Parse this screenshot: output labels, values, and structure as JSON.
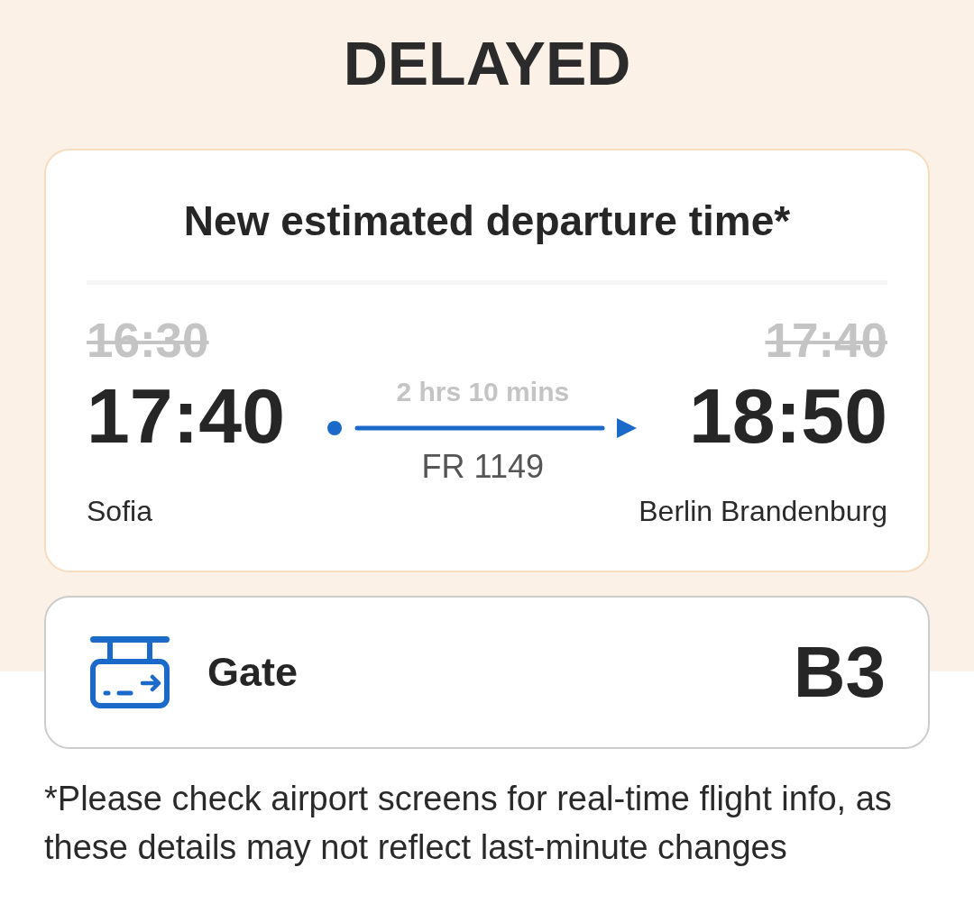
{
  "status": {
    "kind": "delayed",
    "title": "DELAYED"
  },
  "departure_card": {
    "heading": "New estimated departure time*",
    "origin": {
      "scheduled_time": "16:30",
      "estimated_time": "17:40",
      "city": "Sofia"
    },
    "route": {
      "duration": "2 hrs 10 mins",
      "flight_number": "FR 1149"
    },
    "destination": {
      "scheduled_time": "17:40",
      "estimated_time": "18:50",
      "city": "Berlin Brandenburg"
    }
  },
  "gate_card": {
    "label": "Gate",
    "value": "B3"
  },
  "footnote": "*Please check airport screens for real-time flight info, as these details may not reflect last-minute changes"
}
